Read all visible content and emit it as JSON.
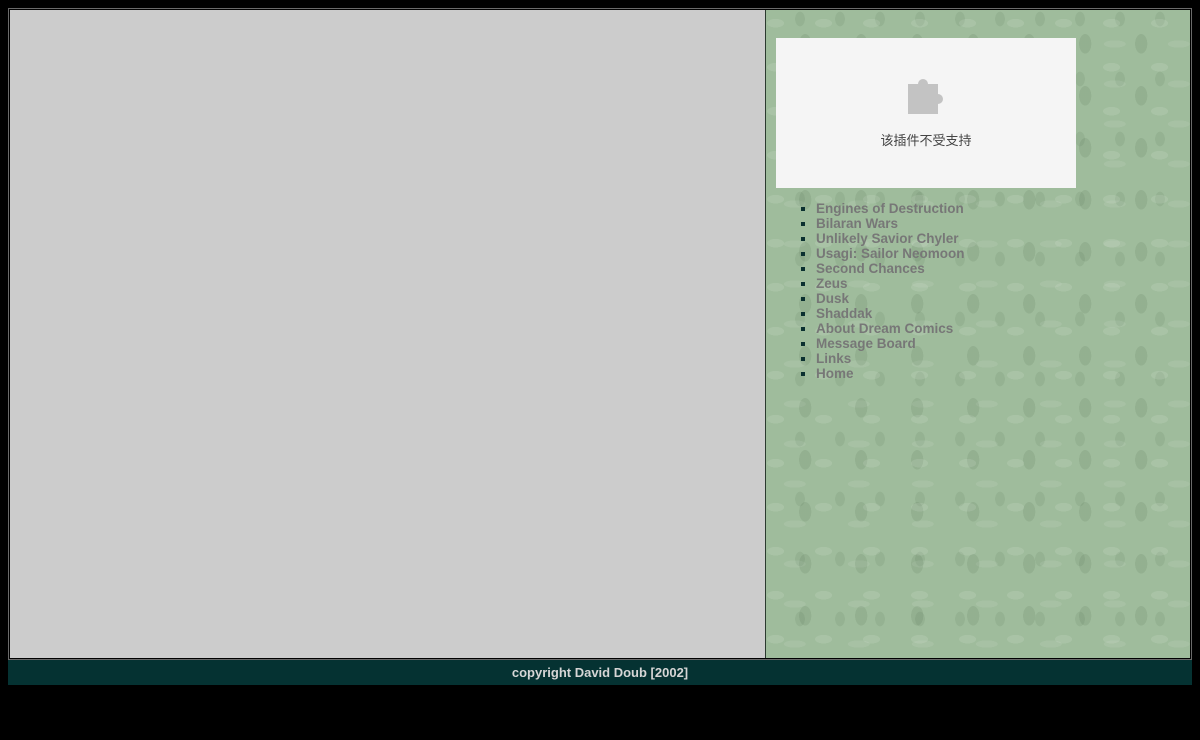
{
  "plugin": {
    "icon": "puzzle-piece-icon",
    "message": "该插件不受支持"
  },
  "nav": {
    "items": [
      {
        "label": "Engines of Destruction"
      },
      {
        "label": "Bilaran Wars"
      },
      {
        "label": "Unlikely Savior Chyler"
      },
      {
        "label": "Usagi: Sailor Neomoon"
      },
      {
        "label": "Second Chances"
      },
      {
        "label": "Zeus"
      },
      {
        "label": "Dusk"
      },
      {
        "label": "Shaddak"
      },
      {
        "label": "About Dream Comics"
      },
      {
        "label": "Message Board"
      },
      {
        "label": "Links"
      },
      {
        "label": "Home"
      }
    ]
  },
  "footer": {
    "copyright": "copyright David Doub [2002]"
  },
  "colors": {
    "page_background": "#000000",
    "left_pane": "#cccccc",
    "right_pane": "#9fbc9c",
    "footer_background": "#053232",
    "link_text": "#777777"
  }
}
